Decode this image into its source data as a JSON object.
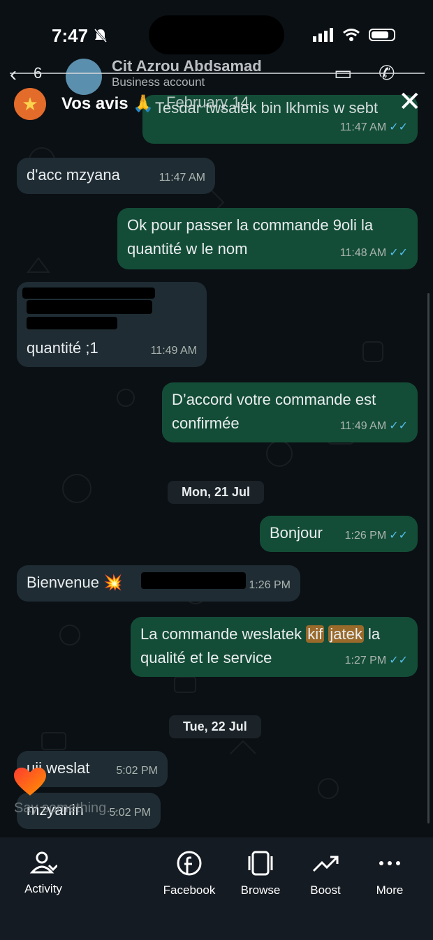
{
  "status_bar": {
    "time": "7:47"
  },
  "header": {
    "back_count": "6",
    "contact_name": "Cit Azrou Abdsamad",
    "contact_subtitle": "Business account"
  },
  "banner": {
    "title": "Vos avis 🙏",
    "overlay_text": "February 14"
  },
  "messages": [
    {
      "dir": "out",
      "text": "Tesdar twsalek bin lkhmis w sebt",
      "time": "11:47 AM",
      "ticks": "✓✓"
    },
    {
      "dir": "in",
      "text": "d'acc  mzyana",
      "time": "11:47 AM"
    },
    {
      "dir": "out",
      "text": "Ok pour passer la commande 9oli la quantité w le nom",
      "time": "11:48 AM",
      "ticks": "✓✓"
    },
    {
      "dir": "in",
      "text": "quantité ;1",
      "time": "11:49 AM"
    },
    {
      "dir": "out",
      "text": "D’accord votre commande est confirmée",
      "time": "11:49 AM",
      "ticks": "✓✓"
    },
    {
      "dir": "out",
      "text": "Bonjour",
      "time": "1:26 PM",
      "ticks": "✓✓"
    },
    {
      "dir": "in",
      "text": "Bienvenue  💥",
      "time": "1:26 PM"
    },
    {
      "dir": "out",
      "text_a": "La commande weslatek ",
      "text_hl1": "kif",
      "text_hl2": "jatek",
      "text_b": " la qualité et le service",
      "time": "1:27 PM",
      "ticks": "✓✓"
    },
    {
      "dir": "in",
      "text": "uii weslat",
      "time": "5:02 PM"
    },
    {
      "dir": "in",
      "text": "mzyanin",
      "time": "5:02 PM"
    }
  ],
  "date_chips": [
    "Mon, 21 Jul",
    "Tue, 22 Jul"
  ],
  "typing_indicator": "Say something...",
  "tabs": [
    {
      "label": "Activity",
      "icon": "activity-icon"
    },
    {
      "label": "Facebook",
      "icon": "facebook-icon"
    },
    {
      "label": "Browse",
      "icon": "browse-icon"
    },
    {
      "label": "Boost",
      "icon": "boost-icon"
    },
    {
      "label": "More",
      "icon": "more-icon"
    }
  ],
  "colors": {
    "outgoing": "#144d37",
    "incoming": "#1f2c33",
    "ticks": "#53bdeb",
    "banner_star": "#e46c2b"
  }
}
